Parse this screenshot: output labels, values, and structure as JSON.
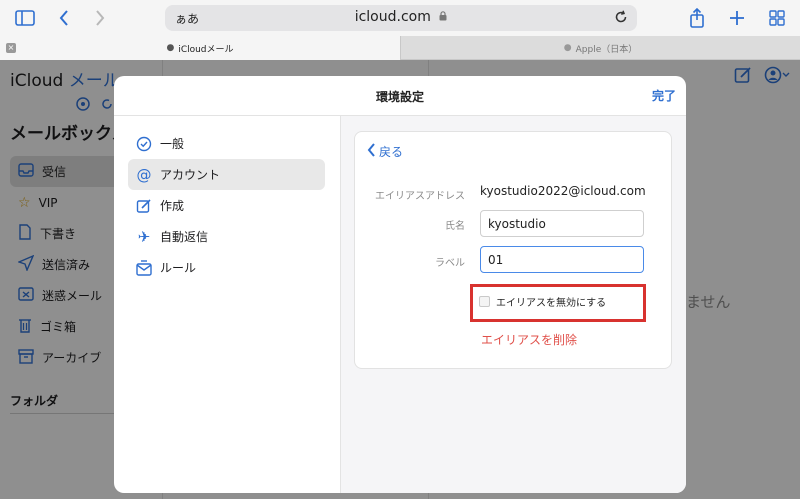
{
  "browser": {
    "url_aa": "ぁあ",
    "url": "icloud.com",
    "tabs": [
      {
        "label": "iCloudメール",
        "active": true
      },
      {
        "label": "Apple（日本）",
        "active": false
      }
    ]
  },
  "mail_app": {
    "title": "iCloud",
    "title_accent": "メール",
    "mailbox_heading": "メールボックス",
    "mailboxes": [
      {
        "label": "受信",
        "icon": "inbox-icon",
        "selected": true
      },
      {
        "label": "VIP",
        "icon": "star-icon"
      },
      {
        "label": "下書き",
        "icon": "document-icon"
      },
      {
        "label": "送信済み",
        "icon": "paper-plane-icon"
      },
      {
        "label": "迷惑メール",
        "icon": "junk-icon"
      },
      {
        "label": "ゴミ箱",
        "icon": "trash-icon"
      },
      {
        "label": "アーカイブ",
        "icon": "archive-icon"
      }
    ],
    "folder_heading": "フォルダ",
    "empty_text_partial": "ません"
  },
  "preferences": {
    "title": "環境設定",
    "done_label": "完了",
    "menu": [
      {
        "label": "一般",
        "icon": "check-circle-icon"
      },
      {
        "label": "アカウント",
        "icon": "at-icon",
        "selected": true
      },
      {
        "label": "作成",
        "icon": "compose-icon"
      },
      {
        "label": "自動返信",
        "icon": "airplane-icon"
      },
      {
        "label": "ルール",
        "icon": "rules-icon"
      }
    ],
    "detail": {
      "back_label": "戻る",
      "alias_address_label": "エイリアスアドレス",
      "alias_address_value": "kyostudio2022@icloud.com",
      "name_label": "氏名",
      "name_value": "kyostudio",
      "label_label": "ラベル",
      "label_value": "01",
      "disable_alias_label": "エイリアスを無効にする",
      "disable_alias_checked": false,
      "delete_alias_label": "エイリアスを削除"
    }
  },
  "colors": {
    "accent": "#2f6fd0",
    "danger": "#e0504a",
    "highlight_box": "#d8322f"
  }
}
